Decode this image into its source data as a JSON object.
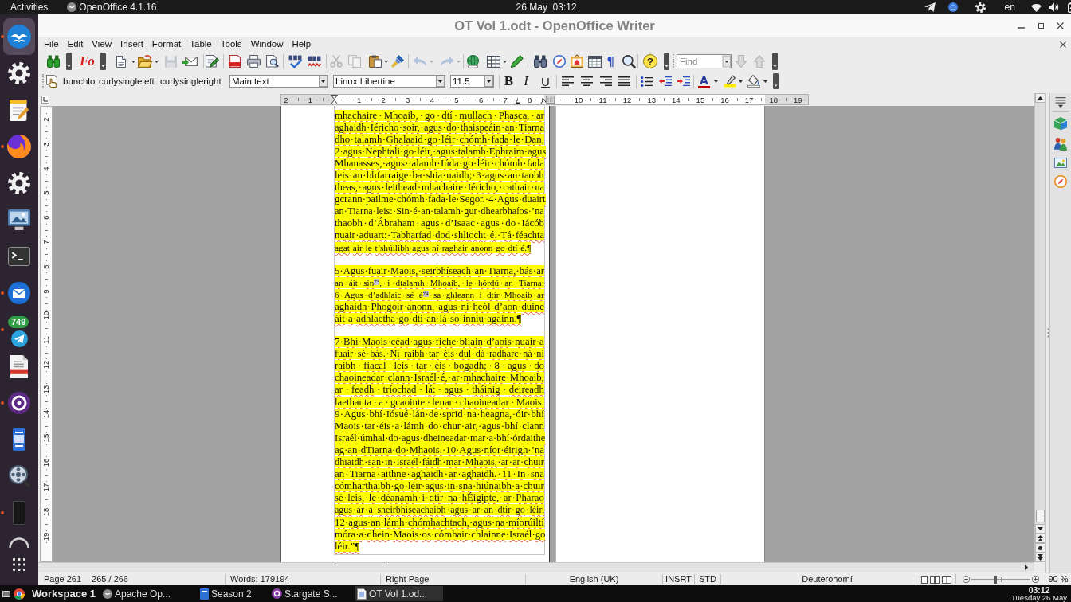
{
  "top_bar": {
    "activities": "Activities",
    "app_menu": "OpenOffice 4.1.16",
    "clock": "26 May  03:12",
    "keyboard_layout": "en"
  },
  "dock": [
    {
      "running": true,
      "selected": true
    },
    {
      "running": false,
      "selected": false
    },
    {
      "running": false,
      "selected": false
    },
    {
      "running": true,
      "selected": false
    },
    {
      "running": false,
      "selected": false
    },
    {
      "running": false,
      "selected": false
    },
    {
      "running": false,
      "selected": false
    },
    {
      "running": true,
      "selected": false
    },
    {
      "running": true,
      "selected": false,
      "badge": "749"
    },
    {
      "running": false,
      "selected": false
    },
    {
      "running": true,
      "selected": false
    },
    {
      "running": false,
      "selected": false
    },
    {
      "running": false,
      "selected": false
    },
    {
      "running": true,
      "selected": false
    },
    {
      "running": false,
      "selected": false
    },
    {
      "running": false,
      "selected": false
    }
  ],
  "window": {
    "title": "OT Vol 1.odt - OpenOffice Writer"
  },
  "menu": [
    "File",
    "Edit",
    "View",
    "Insert",
    "Format",
    "Table",
    "Tools",
    "Window",
    "Help"
  ],
  "standard_toolbar": [
    {
      "disabled": false
    },
    {
      "glyph": "Fo",
      "disabled": false
    },
    {
      "disabled": false
    },
    {
      "disabled": false
    },
    {
      "disabled": true
    },
    {
      "disabled": false
    },
    {
      "disabled": false
    },
    {
      "disabled": false
    },
    {
      "disabled": false
    },
    {
      "disabled": false
    },
    {
      "disabled": false
    },
    {
      "disabled": false
    },
    {
      "disabled": true
    },
    {
      "disabled": true
    },
    {
      "disabled": false
    },
    {
      "disabled": false
    },
    {
      "disabled": true
    },
    {
      "disabled": true
    },
    {
      "disabled": false
    },
    {
      "disabled": false
    },
    {
      "disabled": false
    },
    {
      "disabled": false
    },
    {
      "disabled": false
    },
    {
      "disabled": false
    },
    {
      "disabled": false
    },
    {
      "glyph": "¶",
      "disabled": false
    },
    {
      "disabled": false
    },
    {
      "glyph": "?",
      "disabled": false
    }
  ],
  "find_toolbar": {
    "placeholder": "Find",
    "buttons": [
      {
        "disabled": true
      },
      {
        "disabled": true
      }
    ]
  },
  "formatting_toolbar": {
    "macros": [
      "bunchlo",
      "curlysingleleft",
      "curlysingleright"
    ],
    "paragraph_style": "Main text",
    "font_name": "Linux Libertine",
    "font_size": "11.5",
    "buttons": [
      {
        "glyph": "B"
      },
      {
        "glyph": "I"
      },
      {
        "glyph": "U"
      }
    ],
    "font_color": {
      "glyph": "A"
    }
  },
  "horizontal_ruler": [
    "2",
    "1",
    "1",
    "2",
    "3",
    "4",
    "5",
    "6",
    "7",
    "8",
    "10",
    "11",
    "12",
    "13",
    "14",
    "15",
    "16",
    "17",
    "18",
    "19"
  ],
  "vertical_ruler": [
    "2",
    "3",
    "4",
    "5",
    "6",
    "7",
    "8",
    "9",
    "10",
    "11",
    "12",
    "13",
    "14",
    "15",
    "16",
    "17",
    "18",
    "19"
  ],
  "document": {
    "auto_spellcheck": true,
    "paragraphs": [
      {
        "text": "mhachaire·Mhoaib,·go·dtí·mullach·Phasca,·ar aghaidh·Iéricho·soir,·agus·do·thaispeáin·an·Tiarna dho·talamh·Ghalaaid·go·léir·chómh·fada·le·Dan, 2·agus·Nephtali·go·léir,·agus·talamh·Ephraim·agus Mhanasses,·agus·talamh·Iúda·go·léir·chómh·fada leis·an·bhfarraige·ba·shia·uaidh;·3·agus·an·taobh theas,·agus·leithead·mhachaire·Iéricho,·cathair·na gcrann·pailme·chómh·fada·le·Segor.·4·Agus·duairt an·Tiarna·leis:·Sin·é·an·talamh·gur·dhearbhaíos·’na thaobh·d’Ábraham·agus·d’Isaac·agus·do·Iácób nuair·aduart:·Tabharfad·dod·shliocht·é.·Tá·féachta agat·air·le·t’shúilibh·agus·ní·raghair·anonn·go·dtí·é.¶"
      },
      {
        "text": "5·Agus·fuair·Maois,·seirbhíseach·an·Tiarna,·bás·ar an·áit·sin$^{73}$,·i·dtalamh·Mhoaib,·le·hórdú·an·Tiarna: 6·Agus·d’adhlaic·sé·é$^{74}$·sa·ghleann·i·dtír·Mhoaib·ar aghaidh·Phogoir·anonn,·agus·ní·heól·d’aon·duine áit·a·adhlactha·go·dtí·an·lá·so·inniu·againn.¶"
      },
      {
        "text": "7·Bhí·Maois·céad·agus·fiche·bliain·d’aois·nuair·a fuair·sé·bás.·Ní·raibh·tar·éis·dul·dá·radharc·ná·ní raibh·fiacal·leis·tar·éis·bogadh;·8·agus·do chaoineadar·clann·Israél·é,·ar·mhachaire·Mhoaib, ar·feadh·tríochad·lá:·agus·tháinig·deireadh laethanta·a·gcaointe·lenar·chaoineadar·Maois. 9·Agus·bhí·Iósué·lán·de·sprid·na·heagna,·óir·bhí Maois·tar·éis·a·lámh·do·chur·air,·agus·bhí·clann Israél·úmhal·do·agus·dheineadar·mar·a·bhí·órdaithe ag·an·dTiarna·do·Mhaois.·10·Agus·níor·éirigh·’na dhiaidh·san·in·Israél·fáidh·mar·Mhaois,·ar·ar·chuir an·Tiarna·aithne·aghaidh·ar·aghaidh.·11·In·sna cómharthaibh·go·léir·agus·in·sna·hiúnaibh·a·chuir sé·leis,·le·déanamh·i·dtír·na·hÉigipte,·ar·Pharao agus·ar·a·sheirbhíseachaibh·agus·ar·an·dtír·go·léir, 12·agus·an·lámh·chómhachtach,·agus·na·míorúiltí móra·a·dhein·Maois·os·cómhair·chlainne·Israél·go léir.”¶"
      }
    ]
  },
  "status_bar": {
    "page": "Page 261",
    "page_count": "265 / 266",
    "words": "Words: 179194",
    "view": "Right Page",
    "language": "English (UK)",
    "insert_mode": "INSRT",
    "selection_mode": "STD",
    "page_style": "Deuteronomí",
    "zoom": {
      "level": 0.42,
      "reading": "90 %"
    }
  },
  "taskbar": {
    "workspace": "Workspace 1",
    "tasks": [
      {
        "label": "Apache Op...",
        "selected": false
      },
      {
        "label": "Season 2",
        "selected": false
      },
      {
        "label": "Stargate S...",
        "selected": false
      },
      {
        "label": "OT Vol 1.od...",
        "selected": true
      }
    ],
    "time": "03:12",
    "date": "Tuesday 26 May"
  }
}
